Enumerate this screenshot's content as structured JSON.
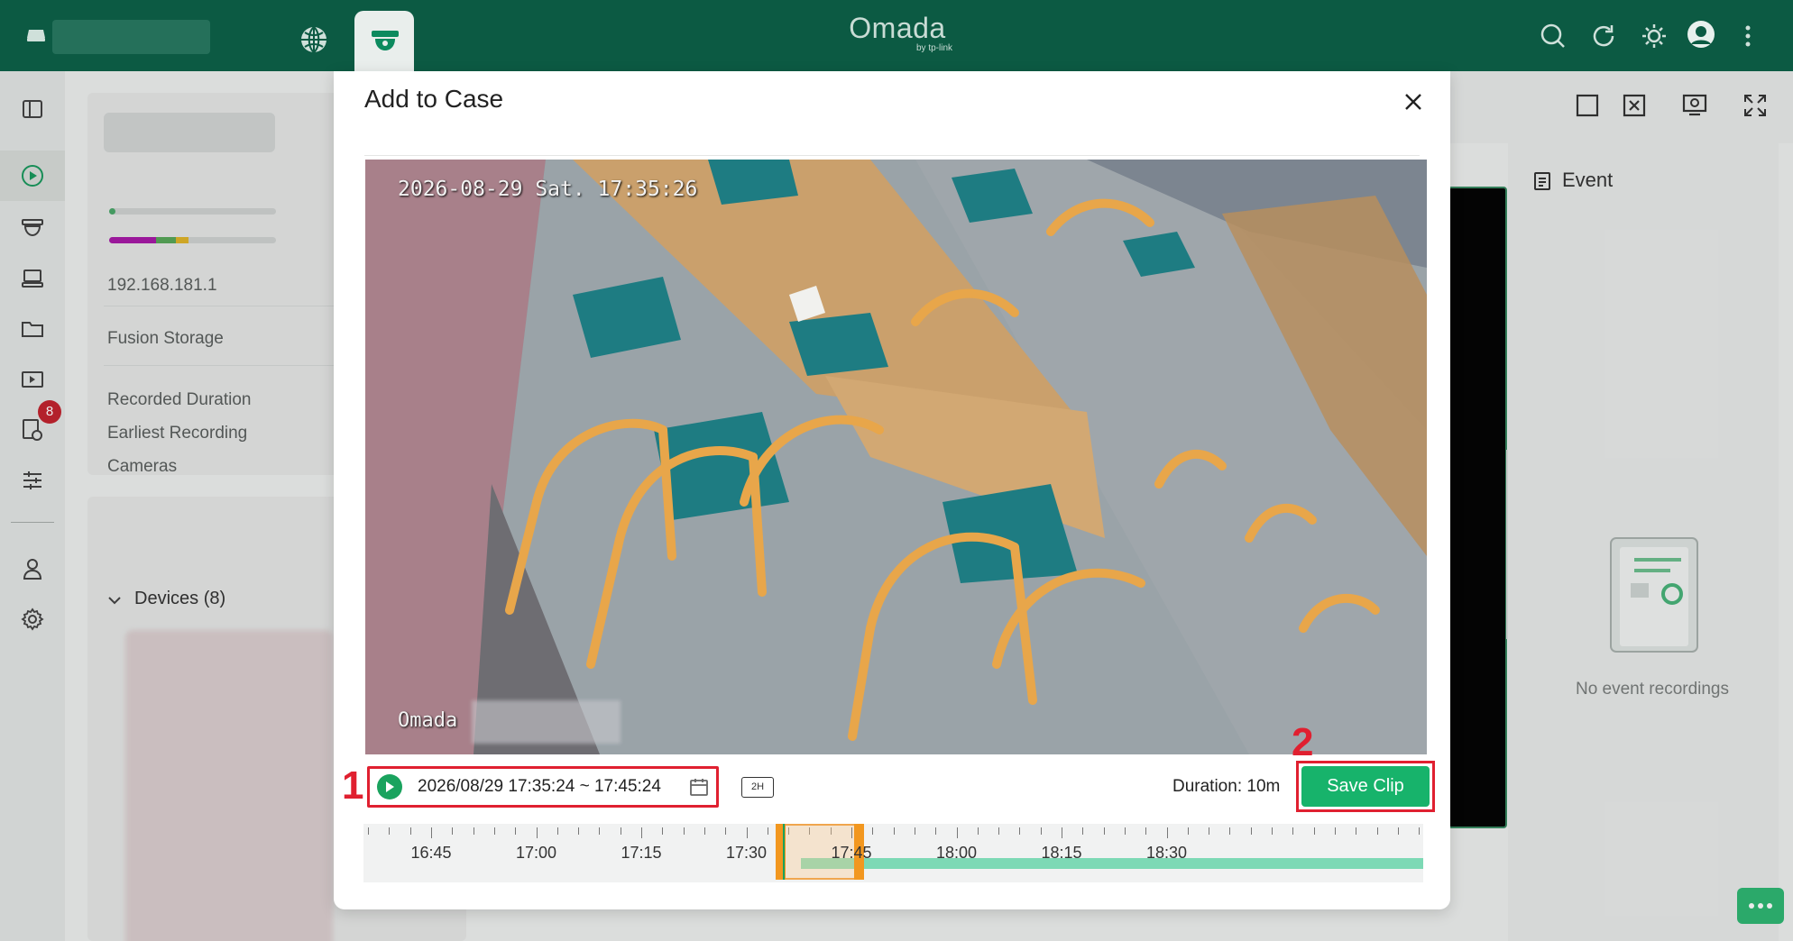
{
  "topbar": {
    "logo": "Omada",
    "logo_sub": "by tp-link"
  },
  "sidebar": {
    "badge_count": "8"
  },
  "storage_card": {
    "ip": "192.168.181.1",
    "storage_type": "Fusion Storage",
    "rows": [
      "Recorded Duration",
      "Earliest Recording",
      "Cameras"
    ]
  },
  "devices": {
    "label": "Devices (8)"
  },
  "event_panel": {
    "title": "Event",
    "empty_text": "No event recordings"
  },
  "modal": {
    "title": "Add to Case",
    "video": {
      "osd_timestamp": "2026-08-29 Sat. 17:35:26",
      "osd_brand": "Omada"
    },
    "range_text": "2026/08/29 17:35:24 ~ 17:45:24",
    "zoom_label": "2H",
    "duration_text": "Duration: 10m",
    "save_label": "Save Clip",
    "annotation_1": "1",
    "annotation_2": "2",
    "timeline": {
      "labels": [
        "16:45",
        "17:00",
        "17:15",
        "17:30",
        "17:45",
        "18:00",
        "18:15",
        "18:30"
      ],
      "selection_start": "17:35:24",
      "selection_end": "17:45:24"
    }
  },
  "colors": {
    "topbar": "#0c5a43",
    "accent": "#17b36b",
    "annotation": "#e02030",
    "selection": "#f2971f",
    "recording": "#7dd9b5"
  }
}
